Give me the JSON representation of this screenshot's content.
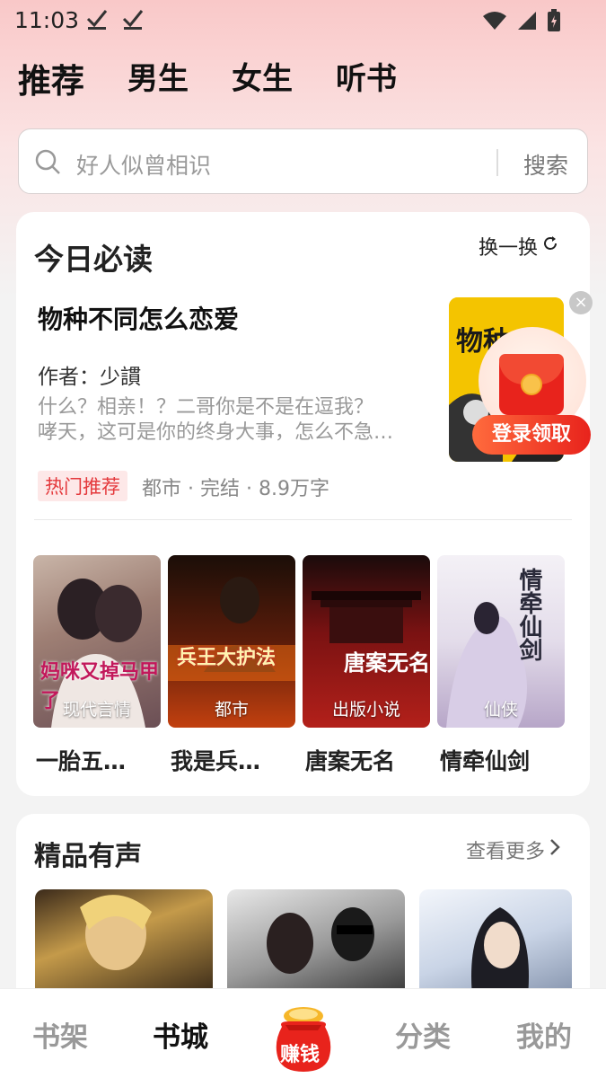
{
  "status_bar": {
    "time": "11:03",
    "check_icons": [
      "check-icon",
      "check-icon"
    ],
    "right_icons": [
      "wifi-icon",
      "signal-icon",
      "battery-charging-icon"
    ]
  },
  "top_tabs": [
    {
      "label": "推荐",
      "active": true
    },
    {
      "label": "男生",
      "active": false
    },
    {
      "label": "女生",
      "active": false
    },
    {
      "label": "听书",
      "active": false
    }
  ],
  "search": {
    "placeholder": "好人似曾相识",
    "button_label": "搜索"
  },
  "today_section": {
    "title": "今日必读",
    "refresh_label": "换一换",
    "featured": {
      "title": "物种不同怎么恋爱",
      "author": "作者：少謴",
      "desc_line1": "什么？相亲！？二哥你是不是在逗我？",
      "desc_line2": "哮天，这可是你的终身大事，怎么不急…",
      "tag": "热门推荐",
      "meta": "都市 · 完结 · 8.9万字",
      "cover_text": "物种",
      "promo_label": "登录领取"
    },
    "books": [
      {
        "genre": "现代言情",
        "name": "一胎五…",
        "cover_text": "妈咪又掉马甲了"
      },
      {
        "genre": "都市",
        "name": "我是兵…",
        "cover_text": "兵王大护法"
      },
      {
        "genre": "出版小说",
        "name": "唐案无名",
        "cover_text": "唐案无名"
      },
      {
        "genre": "仙侠",
        "name": "情牵仙剑",
        "cover_text": "情牵仙剑"
      }
    ]
  },
  "audio_section": {
    "title": "精品有声",
    "more_label": "查看更多"
  },
  "bottom_nav": [
    {
      "label": "书架",
      "active": false
    },
    {
      "label": "书城",
      "active": true
    },
    {
      "label": "赚钱",
      "active": false
    },
    {
      "label": "分类",
      "active": false
    },
    {
      "label": "我的",
      "active": false
    }
  ],
  "colors": {
    "accent_red": "#e4393c",
    "promo_red": "#e8231c",
    "tag_bg": "#fde8e8"
  }
}
